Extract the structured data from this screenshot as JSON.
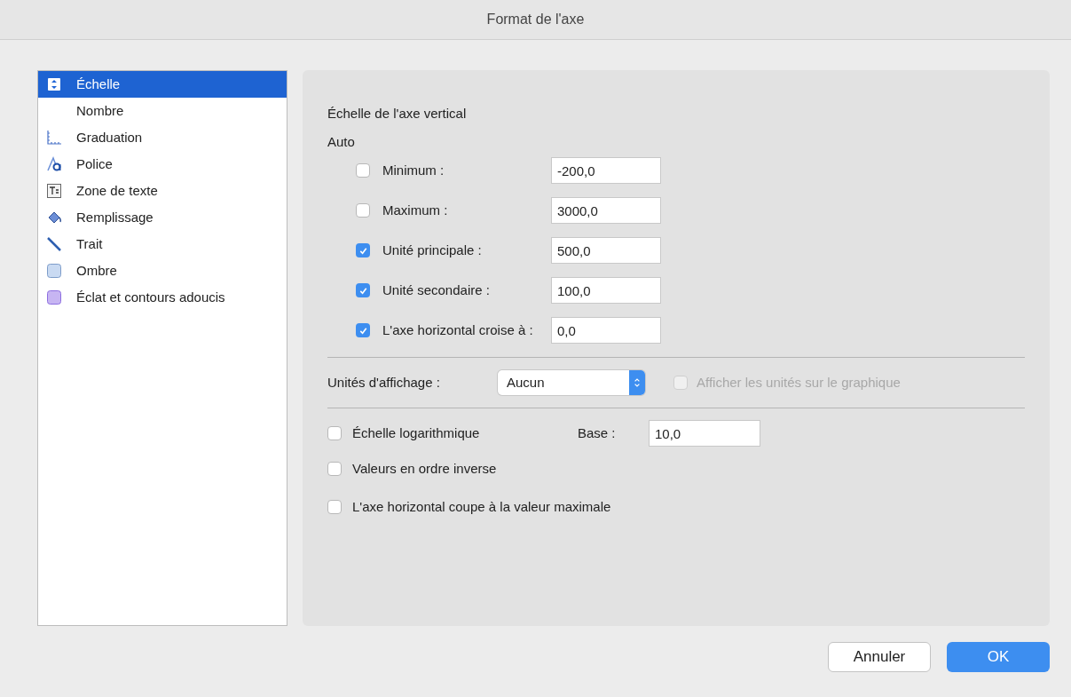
{
  "window": {
    "title": "Format de l'axe"
  },
  "sidebar": {
    "items": [
      {
        "label": "Échelle",
        "kind": "scale",
        "selected": true
      },
      {
        "label": "Nombre",
        "kind": "none",
        "selected": false
      },
      {
        "label": "Graduation",
        "kind": "ticks",
        "selected": false
      },
      {
        "label": "Police",
        "kind": "font",
        "selected": false
      },
      {
        "label": "Zone de texte",
        "kind": "textbox",
        "selected": false
      },
      {
        "label": "Remplissage",
        "kind": "fill",
        "selected": false
      },
      {
        "label": "Trait",
        "kind": "line",
        "selected": false
      },
      {
        "label": "Ombre",
        "kind": "shadow",
        "selected": false
      },
      {
        "label": "Éclat et contours adoucis",
        "kind": "glow",
        "selected": false
      }
    ]
  },
  "section_title": "Échelle de l'axe vertical",
  "auto_label": "Auto",
  "auto_rows": [
    {
      "label": "Minimum :",
      "checked": false,
      "value": "-200,0"
    },
    {
      "label": "Maximum :",
      "checked": false,
      "value": "3000,0"
    },
    {
      "label": "Unité principale :",
      "checked": true,
      "value": "500,0"
    },
    {
      "label": "Unité secondaire :",
      "checked": true,
      "value": "100,0"
    },
    {
      "label": "L'axe horizontal croise à :",
      "checked": true,
      "value": "0,0"
    }
  ],
  "display_units": {
    "label": "Unités d'affichage :",
    "value": "Aucun",
    "show_on_chart": {
      "label": "Afficher les unités sur le graphique",
      "checked": false,
      "disabled": true
    }
  },
  "log_scale": {
    "label": "Échelle logarithmique",
    "checked": false,
    "base_label": "Base :",
    "base_value": "10,0"
  },
  "options": [
    {
      "label": "Valeurs en ordre inverse",
      "checked": false
    },
    {
      "label": "L'axe horizontal coupe à la valeur maximale",
      "checked": false
    }
  ],
  "buttons": [
    {
      "label": "Annuler",
      "kind": "secondary"
    },
    {
      "label": "OK",
      "kind": "primary"
    }
  ]
}
